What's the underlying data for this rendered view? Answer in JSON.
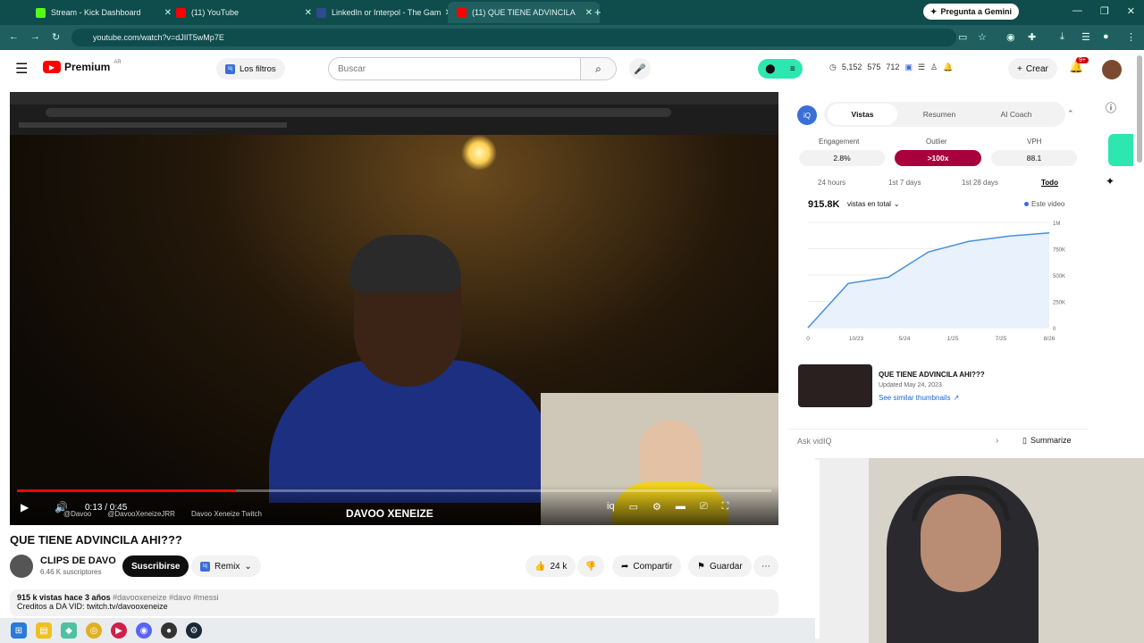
{
  "browser": {
    "tabs": [
      {
        "label": "Stream - Kick Dashboard",
        "favicon_color": "#53fc18"
      },
      {
        "label": "(11) YouTube",
        "favicon_color": "#ff0000"
      },
      {
        "label": "LinkedIn or Interpol - The Gam",
        "favicon_color": "#2d4b8f"
      },
      {
        "label": "(11) QUE TIENE ADVINCILA",
        "favicon_color": "#ff0000"
      }
    ],
    "gemini_label": "Pregunta a Gemini",
    "url": "youtube.com/watch?v=dJIlT5wMp7E"
  },
  "youtube": {
    "logo": "Premium",
    "logo_region": "AR",
    "filters_label": "Los filtros",
    "search_placeholder": "Buscar",
    "stats": {
      "a": "5,152",
      "b": "575",
      "c": "712"
    },
    "create_label": "Crear",
    "notif_badge": "9+"
  },
  "player": {
    "time": "0:13 / 0:45",
    "progress": 0.29,
    "watermark": "DAVOO XENEIZE",
    "overlay_socials": [
      "@Davoo",
      "@DavooXeneizeJRR",
      "Davoo Xeneize Twitch"
    ]
  },
  "video": {
    "title": "QUE TIENE ADVINCILA AHI???",
    "channel": "CLIPS DE DAVO",
    "subscribers": "6.46 K suscriptores",
    "subscribe_label": "Suscribirse",
    "remix_label": "Remix",
    "likes": "24 k",
    "share_label": "Compartir",
    "save_label": "Guardar",
    "desc_line1": "915 k vistas  hace 3 años",
    "desc_tags": "#davooxeneize #davo #messi",
    "desc_line2": "Creditos a DA VID: twitch.tv/davooxeneize"
  },
  "panel": {
    "tabs": [
      "Vistas",
      "Resumen",
      "AI Coach"
    ],
    "active_tab": "Vistas",
    "metrics": [
      {
        "label": "Engagement",
        "value": "2.8%"
      },
      {
        "label": "Outlier",
        "value": ">100x"
      },
      {
        "label": "VPH",
        "value": "88.1"
      }
    ],
    "ranges": [
      "24 hours",
      "1st 7 days",
      "1st 28 days",
      "Todo"
    ],
    "active_range": "Todo",
    "total_views": "915.8K",
    "views_dropdown": "vistas en total",
    "legend": "Este video",
    "related_title": "QUE TIENE ADVINCILA AHI???",
    "related_updated": "Updated May 24, 2023",
    "related_link": "See similar thumbnails",
    "ask_placeholder": "Ask vidIQ",
    "summarize_label": "Summarize"
  },
  "chart_data": {
    "type": "line",
    "x": [
      "0",
      "10/23",
      "5/24",
      "1/25",
      "7/25",
      "8/26"
    ],
    "series": [
      {
        "values": [
          0,
          420,
          480,
          720,
          820,
          870,
          900
        ]
      }
    ],
    "x_ticks": [
      "0",
      "10/23",
      "5/24",
      "1/25",
      "7/25",
      "8/26"
    ],
    "y_ticks": [
      "0",
      "250K",
      "500K",
      "750K",
      "1M"
    ],
    "ylim": [
      0,
      1000000
    ]
  },
  "colors": {
    "outlier_pill": "#a8003c",
    "chart_line": "#4a90d9",
    "youtube_red": "#ff0000",
    "browser_bar": "#0f4c4c"
  }
}
